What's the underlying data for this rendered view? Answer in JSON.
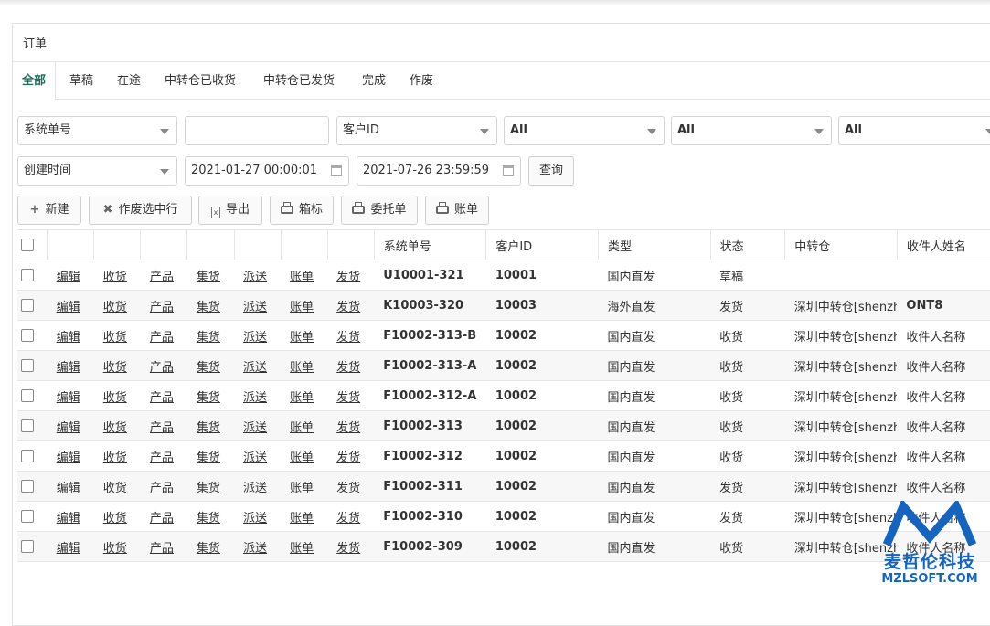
{
  "panel": {
    "title": "订单"
  },
  "tabs": [
    "全部",
    "草稿",
    "在途",
    "中转仓已收货",
    "中转仓已发货",
    "完成",
    "作废"
  ],
  "filters": {
    "field_select": "系统单号",
    "field_value": "",
    "customer_select": "客户ID",
    "select_a": "All",
    "select_b": "All",
    "select_c": "All",
    "time_select": "创建时间",
    "date_from": "2021-01-27 00:00:01",
    "date_to": "2021-07-26 23:59:59",
    "query_label": "查询"
  },
  "toolbar": {
    "new_label": "新建",
    "void_label": "作废选中行",
    "export_label": "导出",
    "label_label": "箱标",
    "consign_label": "委托单",
    "bill_label": "账单"
  },
  "table": {
    "headers": [
      "系统单号",
      "客户ID",
      "类型",
      "状态",
      "中转仓",
      "收件人姓名"
    ],
    "actions": [
      "编辑",
      "收货",
      "产品",
      "集货",
      "派送",
      "账单",
      "发货"
    ],
    "rows": [
      {
        "sid": "U10001-321",
        "cid": "10001",
        "type": "国内直发",
        "status": "草稿",
        "warehouse": "",
        "recipient": ""
      },
      {
        "sid": "K10003-320",
        "cid": "10003",
        "type": "海外直发",
        "status": "发货",
        "warehouse": "深圳中转仓[shenzhen]",
        "recipient": "ONT8"
      },
      {
        "sid": "F10002-313-B",
        "cid": "10002",
        "type": "国内直发",
        "status": "收货",
        "warehouse": "深圳中转仓[shenzhen]",
        "recipient": "收件人名称"
      },
      {
        "sid": "F10002-313-A",
        "cid": "10002",
        "type": "国内直发",
        "status": "收货",
        "warehouse": "深圳中转仓[shenzhen]",
        "recipient": "收件人名称"
      },
      {
        "sid": "F10002-312-A",
        "cid": "10002",
        "type": "国内直发",
        "status": "收货",
        "warehouse": "深圳中转仓[shenzhen]",
        "recipient": "收件人名称"
      },
      {
        "sid": "F10002-313",
        "cid": "10002",
        "type": "国内直发",
        "status": "收货",
        "warehouse": "深圳中转仓[shenzhen]",
        "recipient": "收件人名称"
      },
      {
        "sid": "F10002-312",
        "cid": "10002",
        "type": "国内直发",
        "status": "收货",
        "warehouse": "深圳中转仓[shenzhen]",
        "recipient": "收件人名称"
      },
      {
        "sid": "F10002-311",
        "cid": "10002",
        "type": "国内直发",
        "status": "发货",
        "warehouse": "深圳中转仓[shenzhen]",
        "recipient": "收件人名称"
      },
      {
        "sid": "F10002-310",
        "cid": "10002",
        "type": "国内直发",
        "status": "发货",
        "warehouse": "深圳中转仓[shenzhen]",
        "recipient": "收件人名称"
      },
      {
        "sid": "F10002-309",
        "cid": "10002",
        "type": "国内直发",
        "status": "收货",
        "warehouse": "深圳中转仓[shenzhen]",
        "recipient": "收件人名称"
      }
    ]
  },
  "watermark": {
    "name": "麦哲伦科技",
    "site": "MZLSOFT.COM",
    "color": "#1565c0"
  }
}
